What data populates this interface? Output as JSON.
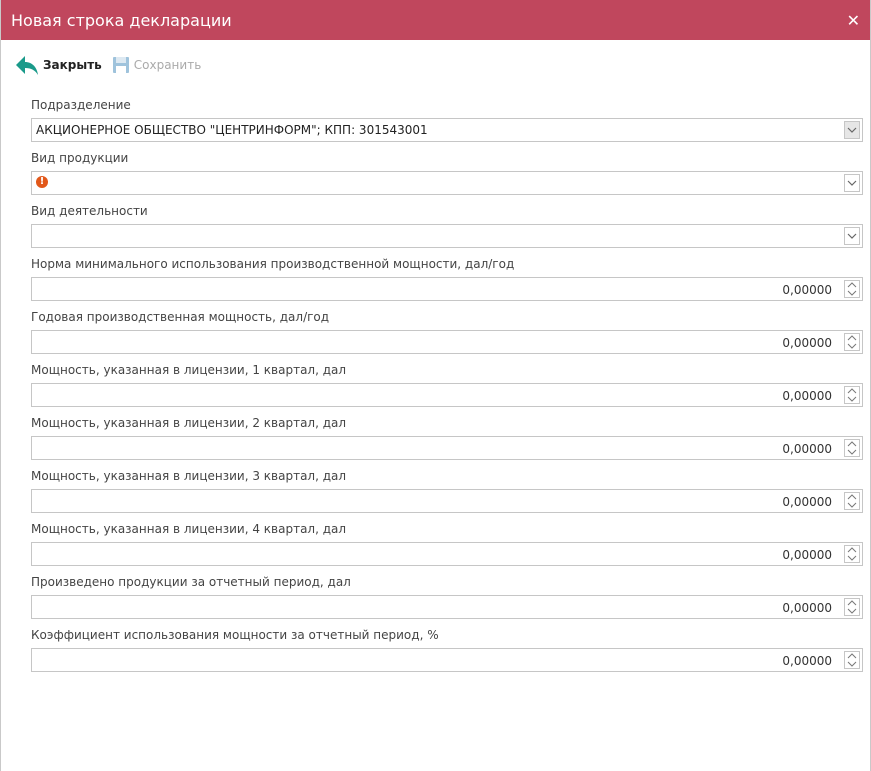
{
  "dialog": {
    "title": "Новая строка декларации"
  },
  "toolbar": {
    "close_label": "Закрыть",
    "save_label": "Сохранить"
  },
  "fields": [
    {
      "label": "Подразделение",
      "type": "select",
      "value": "АКЦИОНЕРНОЕ ОБЩЕСТВО \"ЦЕНТРИНФОРМ\"; КПП: 301543001"
    },
    {
      "label": "Вид продукции",
      "type": "select",
      "value": "",
      "error": true
    },
    {
      "label": "Вид деятельности",
      "type": "select",
      "value": ""
    },
    {
      "label": "Норма минимального использования производственной мощности, дал/год",
      "type": "number",
      "value": "0,00000"
    },
    {
      "label": "Годовая производственная мощность, дал/год",
      "type": "number",
      "value": "0,00000"
    },
    {
      "label": "Мощность, указанная в лицензии, 1 квартал, дал",
      "type": "number",
      "value": "0,00000"
    },
    {
      "label": "Мощность, указанная в лицензии, 2 квартал, дал",
      "type": "number",
      "value": "0,00000"
    },
    {
      "label": "Мощность, указанная в лицензии, 3 квартал, дал",
      "type": "number",
      "value": "0,00000"
    },
    {
      "label": "Мощность, указанная в лицензии, 4 квартал, дал",
      "type": "number",
      "value": "0,00000"
    },
    {
      "label": "Произведено продукции за отчетный период, дал",
      "type": "number",
      "value": "0,00000"
    },
    {
      "label": "Коэффициент использования мощности за отчетный период, %",
      "type": "number",
      "value": "0,00000"
    }
  ],
  "colors": {
    "titlebar": "#c0475d",
    "close_arrow": "#1a9a8a",
    "error": "#e2581a"
  },
  "icons": {
    "close": "back-arrow-icon",
    "save": "floppy-disk-icon",
    "error": "exclamation-icon"
  }
}
